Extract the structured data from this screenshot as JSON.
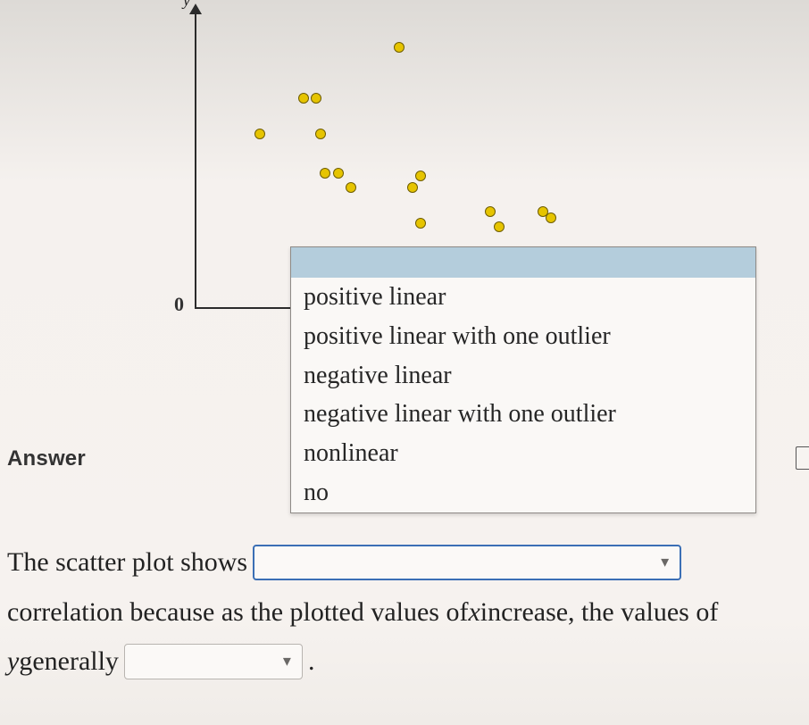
{
  "chart_data": {
    "type": "scatter",
    "xlabel": "",
    "ylabel": "y",
    "origin": "0",
    "points": [
      {
        "x": 0.15,
        "y": 0.58
      },
      {
        "x": 0.25,
        "y": 0.7
      },
      {
        "x": 0.28,
        "y": 0.7
      },
      {
        "x": 0.29,
        "y": 0.58
      },
      {
        "x": 0.3,
        "y": 0.45
      },
      {
        "x": 0.33,
        "y": 0.45
      },
      {
        "x": 0.36,
        "y": 0.4
      },
      {
        "x": 0.47,
        "y": 0.87
      },
      {
        "x": 0.5,
        "y": 0.4
      },
      {
        "x": 0.52,
        "y": 0.44
      },
      {
        "x": 0.52,
        "y": 0.28
      },
      {
        "x": 0.68,
        "y": 0.32
      },
      {
        "x": 0.7,
        "y": 0.27
      },
      {
        "x": 0.8,
        "y": 0.32
      },
      {
        "x": 0.82,
        "y": 0.3
      }
    ]
  },
  "dropdown": {
    "options": [
      "positive linear",
      "positive linear with one outlier",
      "negative linear",
      "negative linear with one outlier",
      "nonlinear",
      "no"
    ]
  },
  "labels": {
    "answer": "Answer"
  },
  "sentence": {
    "p1": "The scatter plot shows",
    "p2": "correlation because as the plotted values of ",
    "xvar": "x",
    "p3": " increase, the values of",
    "yvar": "y",
    "p4": " generally",
    "period": "."
  }
}
